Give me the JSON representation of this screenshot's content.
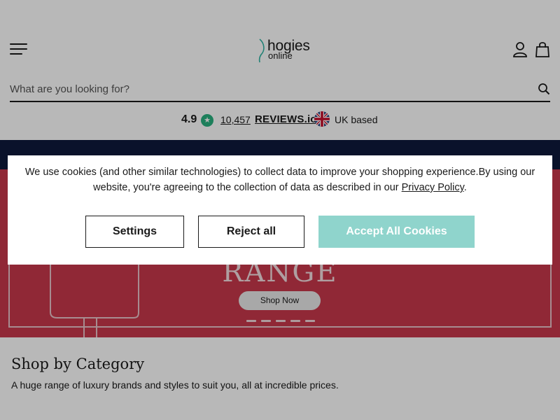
{
  "header": {
    "logo_main": "hogies",
    "logo_sub": "online",
    "search_placeholder": "What are you looking for?"
  },
  "reviews": {
    "rating": "4.9",
    "count": "10,457",
    "brand": "REVIEWS.io",
    "location": "UK based"
  },
  "banner": {
    "headline": "RANGE",
    "cta_label": "Shop Now",
    "slide_count": 5
  },
  "section": {
    "title": "Shop by Category",
    "description": "A huge range of luxury brands and styles to suit you, all at incredible prices."
  },
  "cookie": {
    "message": "We use cookies (and other similar technologies) to collect data to improve your shopping experience.By using our website, you're agreeing to the collection of data as described in our ",
    "privacy_link": "Privacy Policy",
    "message_end": ".",
    "settings_label": "Settings",
    "reject_label": "Reject all",
    "accept_label": "Accept All Cookies"
  },
  "colors": {
    "accent_teal": "#8fd4cc",
    "banner_red": "#c8384c",
    "banner_navy": "#0f1a3c",
    "star_green": "#29b07f"
  },
  "icons": [
    "menu-icon",
    "account-icon",
    "bag-icon",
    "search-icon",
    "star-icon",
    "uk-flag-icon"
  ]
}
